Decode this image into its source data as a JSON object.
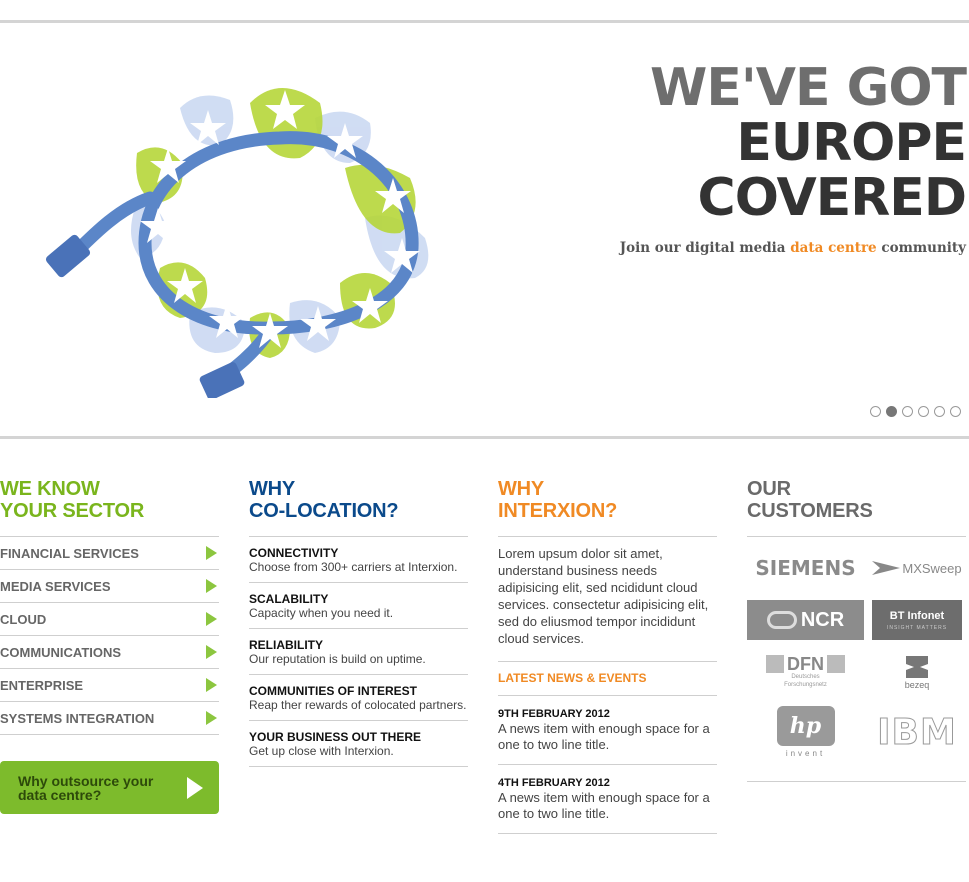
{
  "hero": {
    "headline": [
      "WE'VE GOT",
      "EUROPE",
      "COVERED"
    ],
    "tagline_before": "Join our digital media ",
    "tagline_accent": "data centre",
    "tagline_after": " community",
    "slide_count": 6,
    "active_slide": 2
  },
  "sector": {
    "title_line1": "WE KNOW",
    "title_line2": "YOUR SECTOR",
    "items": [
      "FINANCIAL SERVICES",
      "MEDIA SERVICES",
      "CLOUD",
      "COMMUNICATIONS",
      "ENTERPRISE",
      "SYSTEMS INTEGRATION"
    ],
    "cta_label": "Why outsource your data centre?"
  },
  "colocation": {
    "title_line1": "WHY",
    "title_line2": "CO-LOCATION?",
    "items": [
      {
        "title": "CONNECTIVITY",
        "desc": "Choose from 300+ carriers at Interxion."
      },
      {
        "title": "SCALABILITY",
        "desc": "Capacity when you need it."
      },
      {
        "title": "RELIABILITY",
        "desc": "Our reputation is build on uptime."
      },
      {
        "title": "COMMUNITIES OF INTEREST",
        "desc": "Reap ther rewards of colocated partners."
      },
      {
        "title": "YOUR BUSINESS OUT THERE",
        "desc": "Get up close with Interxion."
      }
    ]
  },
  "interxion": {
    "title_line1": "WHY",
    "title_line2": "INTERXION?",
    "intro": "Lorem upsum dolor sit amet, understand business needs adipisicing elit, sed ncididunt cloud services. consectetur adipisicing elit, sed do eliusmod tempor incididunt cloud services.",
    "news_heading": "LATEST NEWS & EVENTS",
    "news": [
      {
        "date": "9TH FEBRUARY 2012",
        "text": "A news item with enough space for a one to two line title."
      },
      {
        "date": "4TH FEBRUARY 2012",
        "text": "A news item with enough space for a one to two line title."
      }
    ]
  },
  "customers": {
    "title_line1": "OUR",
    "title_line2": "CUSTOMERS",
    "logos": {
      "siemens": "SIEMENS",
      "mxsweep": "MXSweep",
      "ncr": "NCR",
      "bt": "BT",
      "bt_infonet": "Infonet",
      "bt_sub": "INSIGHT MATTERS",
      "dfn": "DFN",
      "dfn_sub1": "Deutsches",
      "dfn_sub2": "Forschungsnetz",
      "bezeq": "bezeq",
      "hp": "hp",
      "hp_sub": "invent",
      "ibm": "IBM"
    }
  },
  "colors": {
    "green": "#7ab51d",
    "blue": "#0b4a8b",
    "orange": "#f08a24",
    "cta": "#7dbb2c",
    "cable": "#5b86c8",
    "star_bg": "#b6d63a"
  }
}
